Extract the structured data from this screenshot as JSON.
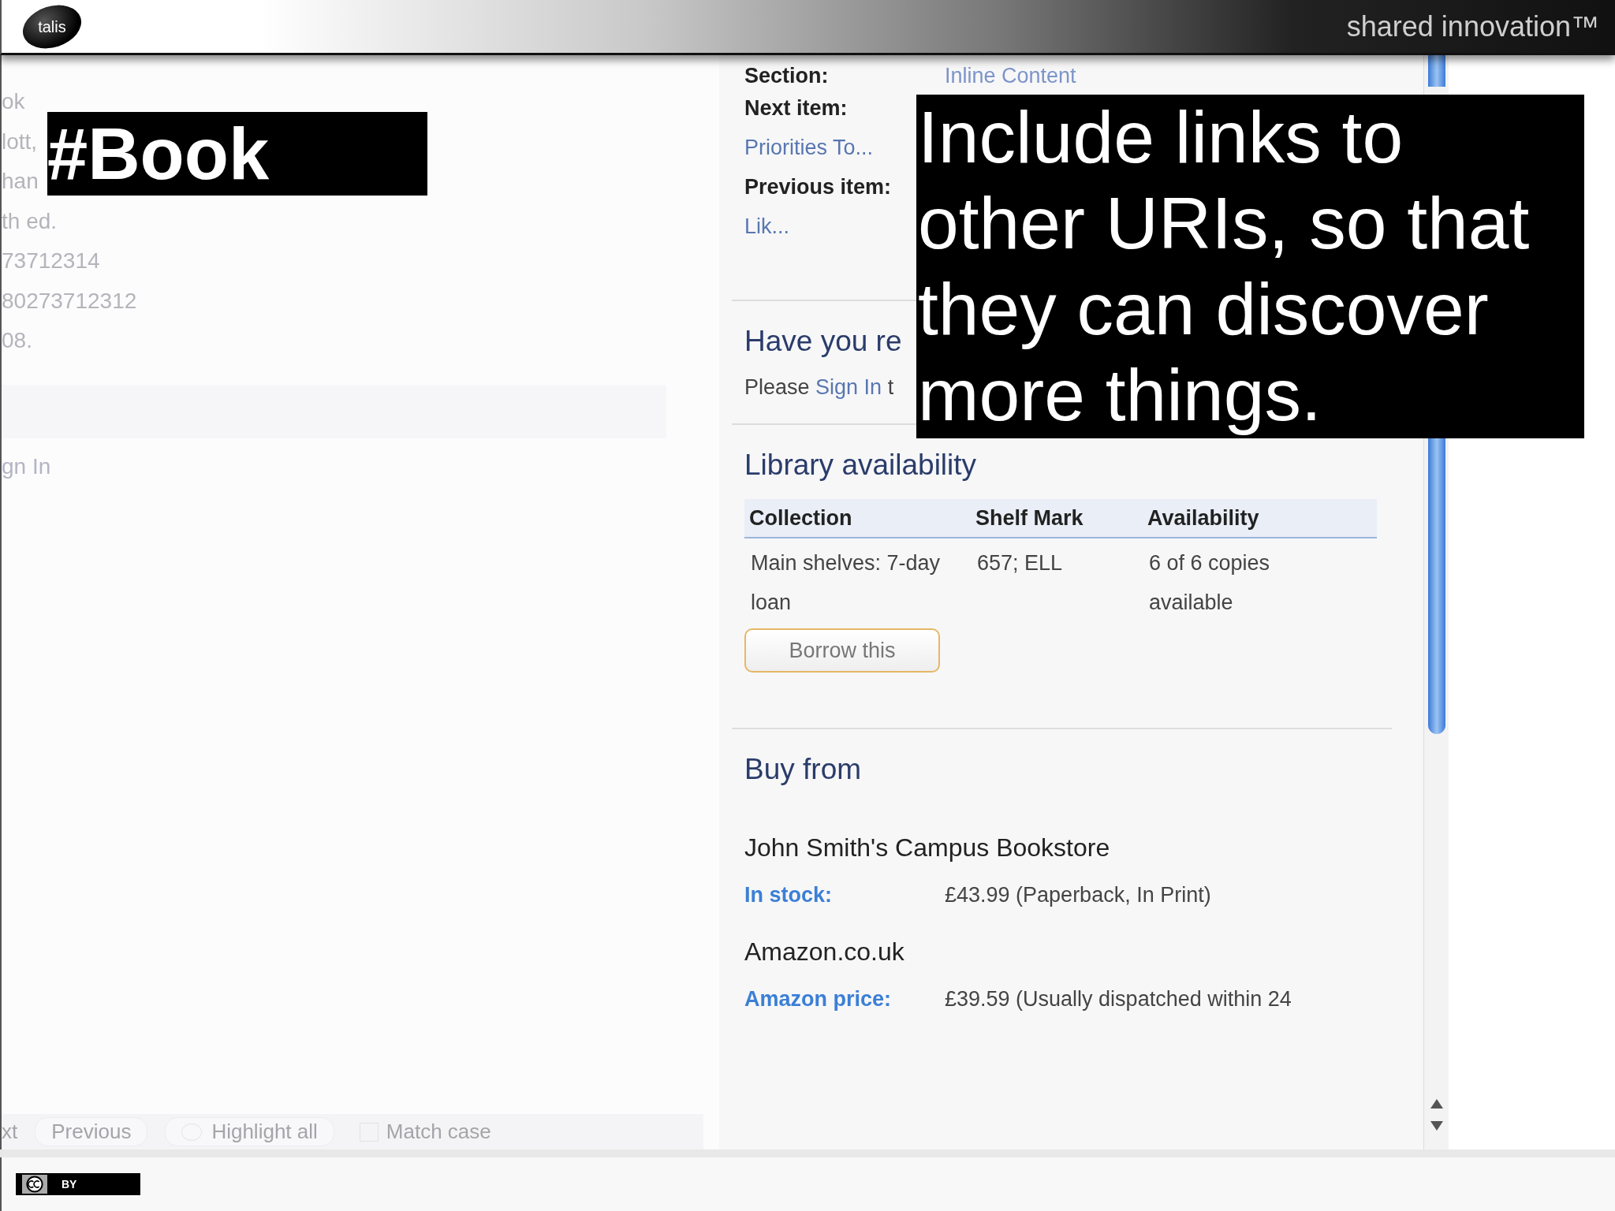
{
  "slide": {
    "logo": "talis",
    "tagline": "shared innovation™",
    "title": "#Book",
    "callout": "Include links to other URIs, so that they can discover more things.",
    "license": "BY"
  },
  "background_page": {
    "lines": [
      "ok",
      "lott,",
      "han",
      "th ed.",
      "73712314",
      "80273712312",
      "08."
    ],
    "sign_in": "gn In",
    "find_bar": {
      "next": "xt",
      "previous": "Previous",
      "highlight": "Highlight all",
      "match_case": {
        "label": "Match case",
        "checked": false
      }
    }
  },
  "detail_pane": {
    "section_label": "Section:",
    "section_value": "Inline Content",
    "next_label": "Next item:",
    "next_link": "Priorities To...",
    "previous_label": "Previous item:",
    "previous_link": "Lik...",
    "review_heading": "Have you re",
    "sign_in": {
      "before": "Please",
      "link": "Sign In",
      "after": "t"
    },
    "library": {
      "heading": "Library availability",
      "columns": [
        "Collection",
        "Shelf Mark",
        "Availability"
      ],
      "rows": [
        {
          "cells": [
            "Main shelves: 7-day loan",
            "657; ELL",
            "6 of 6 copies available"
          ]
        }
      ],
      "button": "Borrow this"
    },
    "buy": {
      "heading": "Buy from",
      "vendors": [
        {
          "name": "John Smith's Campus Bookstore",
          "label": "In stock:",
          "price": "£43.99 (Paperback, In Print)"
        },
        {
          "name": "Amazon.co.uk",
          "label": "Amazon price:",
          "price": "£39.59 (Usually dispatched within 24"
        }
      ]
    }
  }
}
